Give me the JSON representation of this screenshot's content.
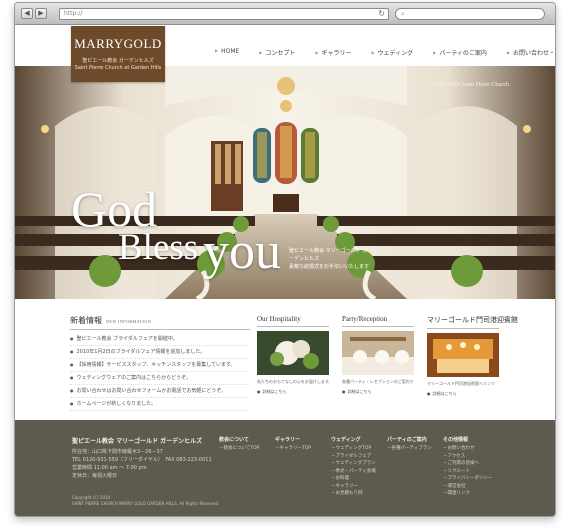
{
  "browser": {
    "back_icon": "back-arrow-icon",
    "forward_icon": "forward-arrow-icon",
    "address": "http://",
    "search_icon": "search-icon",
    "reload_icon": "reload-icon"
  },
  "brand": {
    "logo_text": "MARRYGOLD",
    "logo_sub_jp": "聖ピエール教会 ガーデンヒルズ",
    "logo_sub_en": "Saint Pierre Church at Garden Hills",
    "logo_color": "#6d4b2a"
  },
  "nav": {
    "items": [
      {
        "label": "HOME"
      },
      {
        "label": "コンセプト"
      },
      {
        "label": "ギャラリー"
      },
      {
        "label": "ウェディング"
      },
      {
        "label": "パーティのご案内"
      },
      {
        "label": "お問い合わせ・その他情報"
      }
    ]
  },
  "hero": {
    "label": "Garden Hills Saint Pierre Church",
    "line1": "God",
    "line2": "Bless",
    "line3": "you",
    "caption_1": "聖ピエール教会 マリーゴールド ガーデンヒルズ",
    "caption_2": "素敵な結婚式をお手伝いいたします"
  },
  "news": {
    "title": "新着情報",
    "title_en": "NEW INFORMATION",
    "items": [
      {
        "text": "聖ピエール教会 ブライダルフェアを開催中。"
      },
      {
        "text": "2010年1月2日のブライダルフェア情報を追加しました。"
      },
      {
        "text": "【採用情報】サービススタッフ、キッチンスタッフを募集しています。"
      },
      {
        "text": "ウェディングウェアのご案内はこちらからどうぞ。"
      },
      {
        "text": "お問い合わせはお問い合わせフォームかお電話でお気軽にどうぞ。"
      },
      {
        "text": "ホームページが新しくなりました。"
      }
    ]
  },
  "cards": [
    {
      "title": "Our Hospitality",
      "desc": "私たちのおもてなしの心をお届けします。",
      "more": "詳細はこちら"
    },
    {
      "title": "Party/Reception",
      "desc": "各種パーティ・レセプションのご案内です。",
      "more": "詳細はこちら"
    },
    {
      "title": "マリーゴールド門司港迎賓館",
      "desc": "マリーゴールド門司港迎賓館へリンク",
      "more": "詳細はこちら"
    }
  ],
  "footer": {
    "company": "聖ピエール教会 マリーゴールド ガーデンヒルズ",
    "address_lines": [
      "所在地：山口県下関市綾羅木3－26－37",
      "TEL 0120-931-559（フリーダイヤル）　FAX 083-223-0011",
      "営業時間 11:00 am ～ 7:00 pm",
      "定休日：毎週火曜日"
    ],
    "copyright_1": "Copyright (C) 2010",
    "copyright_2": "SAINT PIERRE CHURCH MARRY GOLD GARDEN HILLS. All Rights Reserved.",
    "columns": [
      {
        "heading": "教会について",
        "links": [
          "－教会についてTOP"
        ]
      },
      {
        "heading": "ギャラリー",
        "links": [
          "－ギャラリーTOP"
        ]
      },
      {
        "heading": "ウェディング",
        "links": [
          "－ウェディングTOP",
          "－ブライダルフェア",
          "－ウェディングプラン",
          "－挙式・パーティ会場",
          "－お料理",
          "－ギャラリー",
          "－お見積もり例"
        ]
      },
      {
        "heading": "パーティのご案内",
        "links": [
          "－各種パーティプラン"
        ]
      },
      {
        "heading": "その他情報",
        "links": [
          "－お問い合わせ",
          "－アクセス",
          "－ご列席の皆様へ",
          "－リクルート",
          "－プライバシーポリシー",
          "－運営会社",
          "－関連リンク"
        ]
      }
    ],
    "bg_color": "#5f5a50"
  }
}
